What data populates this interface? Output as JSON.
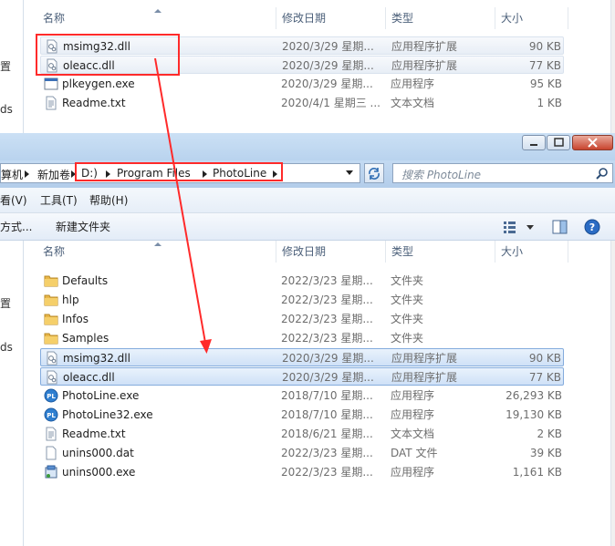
{
  "columns": {
    "name": "名称",
    "date": "修改日期",
    "type": "类型",
    "size": "大小"
  },
  "top_window": {
    "nav_fragments": [
      "置",
      "ds"
    ],
    "files": [
      {
        "name": "msimg32.dll",
        "date": "2020/3/29 星期...",
        "type": "应用程序扩展",
        "size": "90 KB",
        "icon": "dll-icon",
        "state": "selected"
      },
      {
        "name": "oleacc.dll",
        "date": "2020/3/29 星期...",
        "type": "应用程序扩展",
        "size": "77 KB",
        "icon": "dll-icon",
        "state": "selected"
      },
      {
        "name": "plkeygen.exe",
        "date": "2020/3/29 星期...",
        "type": "应用程序",
        "size": "95 KB",
        "icon": "exe-icon",
        "state": ""
      },
      {
        "name": "Readme.txt",
        "date": "2020/4/1 星期三 ...",
        "type": "文本文档",
        "size": "1 KB",
        "icon": "txt-icon",
        "state": ""
      }
    ]
  },
  "front_window": {
    "breadcrumb_prefix": [
      "算机",
      "新加卷"
    ],
    "address_path": [
      "D:)",
      "Program Files",
      "PhotoLine"
    ],
    "search_placeholder": "搜索 PhotoLine",
    "menu": [
      "看(V)",
      "工具(T)",
      "帮助(H)"
    ],
    "toolbar": [
      "方式...",
      "新建文件夹"
    ],
    "nav_fragments": [
      "置",
      "ds"
    ],
    "files": [
      {
        "name": "Defaults",
        "date": "2022/3/23 星期...",
        "type": "文件夹",
        "size": "",
        "icon": "folder-icon",
        "state": ""
      },
      {
        "name": "hlp",
        "date": "2022/3/23 星期...",
        "type": "文件夹",
        "size": "",
        "icon": "folder-icon",
        "state": ""
      },
      {
        "name": "Infos",
        "date": "2022/3/23 星期...",
        "type": "文件夹",
        "size": "",
        "icon": "folder-icon",
        "state": ""
      },
      {
        "name": "Samples",
        "date": "2022/3/23 星期...",
        "type": "文件夹",
        "size": "",
        "icon": "folder-icon",
        "state": ""
      },
      {
        "name": "msimg32.dll",
        "date": "2020/3/29 星期...",
        "type": "应用程序扩展",
        "size": "90 KB",
        "icon": "dll-icon",
        "state": "selected"
      },
      {
        "name": "oleacc.dll",
        "date": "2020/3/29 星期...",
        "type": "应用程序扩展",
        "size": "77 KB",
        "icon": "dll-icon",
        "state": "selected"
      },
      {
        "name": "PhotoLine.exe",
        "date": "2018/7/10 星期...",
        "type": "应用程序",
        "size": "26,293 KB",
        "icon": "photoline-icon",
        "state": ""
      },
      {
        "name": "PhotoLine32.exe",
        "date": "2018/7/10 星期...",
        "type": "应用程序",
        "size": "19,130 KB",
        "icon": "photoline-icon",
        "state": ""
      },
      {
        "name": "Readme.txt",
        "date": "2018/6/21 星期...",
        "type": "文本文档",
        "size": "2 KB",
        "icon": "txt-icon",
        "state": ""
      },
      {
        "name": "unins000.dat",
        "date": "2022/3/23 星期...",
        "type": "DAT 文件",
        "size": "39 KB",
        "icon": "dat-icon",
        "state": ""
      },
      {
        "name": "unins000.exe",
        "date": "2022/3/23 星期...",
        "type": "应用程序",
        "size": "1,161 KB",
        "icon": "installer-icon",
        "state": ""
      }
    ]
  },
  "colors": {
    "annotation": "#ff2a2a",
    "selection_border": "#84acdd",
    "titlebar": "#bcd5ef"
  }
}
